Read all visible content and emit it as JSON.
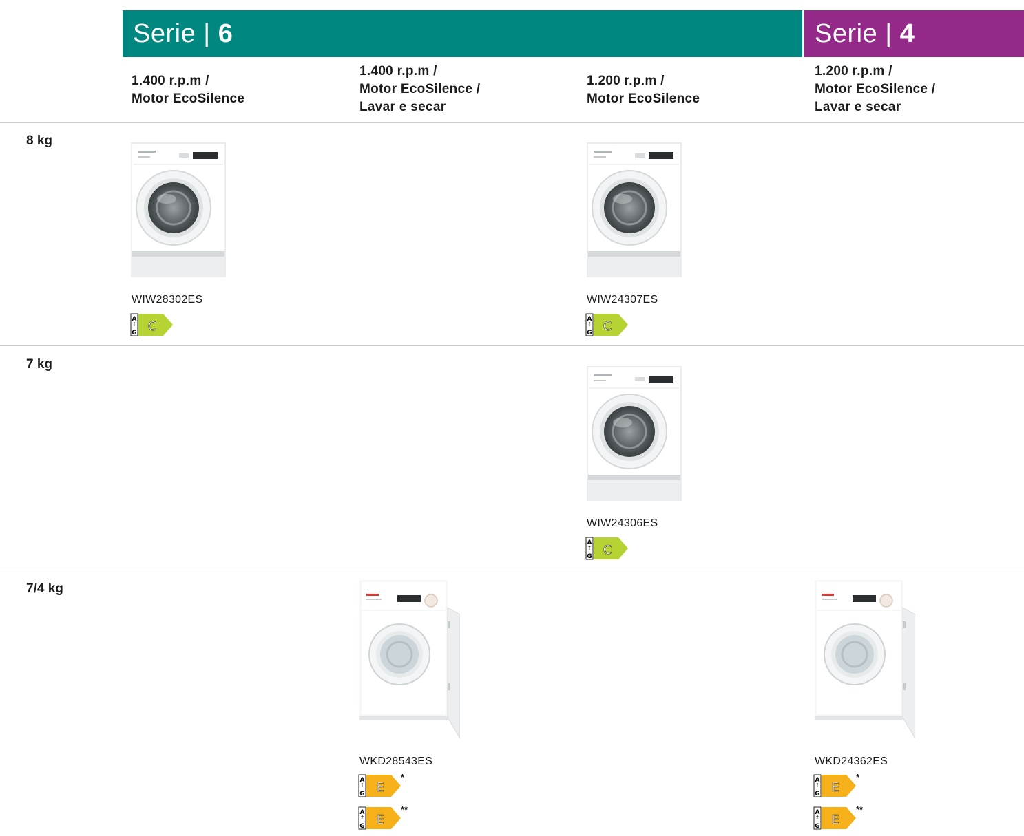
{
  "series": [
    {
      "label": "Serie",
      "sep": "|",
      "number": "6",
      "color": "#00877f"
    },
    {
      "label": "Serie",
      "sep": "|",
      "number": "4",
      "color": "#94298a"
    }
  ],
  "columns": [
    {
      "heading": "1.400 r.p.m /\nMotor EcoSilence"
    },
    {
      "heading": "1.400 r.p.m /\nMotor EcoSilence /\nLavar e secar"
    },
    {
      "heading": "1.200 r.p.m /\nMotor EcoSilence"
    },
    {
      "heading": "1.200 r.p.m /\nMotor EcoSilence /\nLavar e secar"
    }
  ],
  "rows": [
    {
      "label": "8 kg"
    },
    {
      "label": "7 kg"
    },
    {
      "label": "7/4 kg"
    }
  ],
  "products": [
    {
      "model": "WIW28302ES",
      "type": "washer",
      "energy": [
        {
          "scale_top": "A",
          "scale_bottom": "G",
          "class": "C",
          "color": "#b6d334",
          "note": ""
        }
      ]
    },
    {
      "model": "WIW24307ES",
      "type": "washer",
      "energy": [
        {
          "scale_top": "A",
          "scale_bottom": "G",
          "class": "C",
          "color": "#b6d334",
          "note": ""
        }
      ]
    },
    {
      "model": "WIW24306ES",
      "type": "washer",
      "energy": [
        {
          "scale_top": "A",
          "scale_bottom": "G",
          "class": "C",
          "color": "#b6d334",
          "note": ""
        }
      ]
    },
    {
      "model": "WKD28543ES",
      "type": "washer-dryer",
      "energy": [
        {
          "scale_top": "A",
          "scale_bottom": "G",
          "class": "E",
          "color": "#f6b11a",
          "note": "*"
        },
        {
          "scale_top": "A",
          "scale_bottom": "G",
          "class": "E",
          "color": "#f6b11a",
          "note": "**"
        }
      ]
    },
    {
      "model": "WKD24362ES",
      "type": "washer-dryer",
      "energy": [
        {
          "scale_top": "A",
          "scale_bottom": "G",
          "class": "E",
          "color": "#f6b11a",
          "note": "*"
        },
        {
          "scale_top": "A",
          "scale_bottom": "G",
          "class": "E",
          "color": "#f6b11a",
          "note": "**"
        }
      ]
    }
  ]
}
